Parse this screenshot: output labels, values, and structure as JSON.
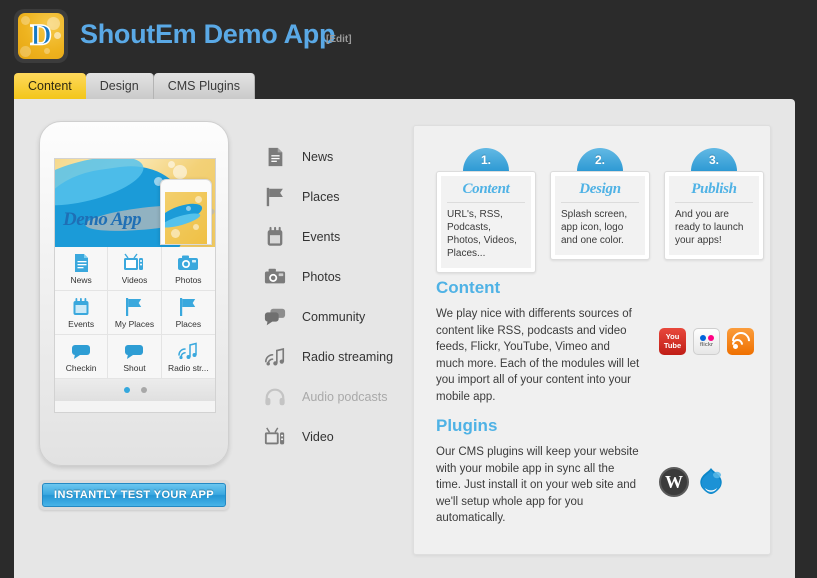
{
  "header": {
    "app_title": "ShoutEm Demo App",
    "edit_label": "[Edit]",
    "logo_letter": "D",
    "title_color": "#5aa9e6"
  },
  "tabs": [
    {
      "label": "Content",
      "active": true
    },
    {
      "label": "Design",
      "active": false
    },
    {
      "label": "CMS Plugins",
      "active": false
    }
  ],
  "phone": {
    "banner_title": "Demo App",
    "grid": [
      {
        "label": "News",
        "icon": "document-icon"
      },
      {
        "label": "Videos",
        "icon": "tv-icon"
      },
      {
        "label": "Photos",
        "icon": "camera-icon"
      },
      {
        "label": "Events",
        "icon": "calendar-icon"
      },
      {
        "label": "My Places",
        "icon": "flag-icon"
      },
      {
        "label": "Places",
        "icon": "flag-icon"
      },
      {
        "label": "Checkin",
        "icon": "speech-bubble-icon"
      },
      {
        "label": "Shout",
        "icon": "speech-bubble-icon"
      },
      {
        "label": "Radio str...",
        "icon": "radio-note-icon"
      }
    ],
    "pager": {
      "pages": 2,
      "active_page": 1,
      "active_color": "#35a8dd"
    }
  },
  "cta": {
    "label": "INSTANTLY TEST YOUR APP"
  },
  "features": [
    {
      "label": "News",
      "icon": "document-icon",
      "disabled": false
    },
    {
      "label": "Places",
      "icon": "flag-icon",
      "disabled": false
    },
    {
      "label": "Events",
      "icon": "calendar-icon",
      "disabled": false
    },
    {
      "label": "Photos",
      "icon": "camera-icon",
      "disabled": false
    },
    {
      "label": "Community",
      "icon": "speech-bubble-icon",
      "disabled": false
    },
    {
      "label": "Radio streaming",
      "icon": "radio-note-icon",
      "disabled": false
    },
    {
      "label": "Audio podcasts",
      "icon": "headphones-icon",
      "disabled": true
    },
    {
      "label": "Video",
      "icon": "tv-icon",
      "disabled": false
    }
  ],
  "steps": [
    {
      "number": "1.",
      "name": "Content",
      "desc": "URL's, RSS, Podcasts, Photos, Videos, Places..."
    },
    {
      "number": "2.",
      "name": "Design",
      "desc": "Splash screen, app icon, logo and one color."
    },
    {
      "number": "3.",
      "name": "Publish",
      "desc": "And you are ready to launch your apps!"
    }
  ],
  "sections": [
    {
      "heading": "Content",
      "text": "We play nice with differents sources of content like RSS, podcasts and video feeds, Flickr, YouTube, Vimeo and much more. Each of the modules will let you import all of your content into your mobile app.",
      "icons": [
        "youtube-icon",
        "flickr-icon",
        "rss-icon"
      ],
      "youtube_line1": "You",
      "youtube_line2": "Tube",
      "flickr_label": "flickr",
      "wordpress_letter": "W"
    },
    {
      "heading": "Plugins",
      "text": "Our CMS plugins will keep your website with your mobile app in sync all the time. Just install it on your web site and we'll setup whole app for you automatically.",
      "icons": [
        "wordpress-icon",
        "drupal-icon"
      ]
    }
  ],
  "colors": {
    "accent_blue": "#4fb2e5",
    "tab_active": "#f2c517",
    "panel_bg": "#e6e6e6"
  }
}
